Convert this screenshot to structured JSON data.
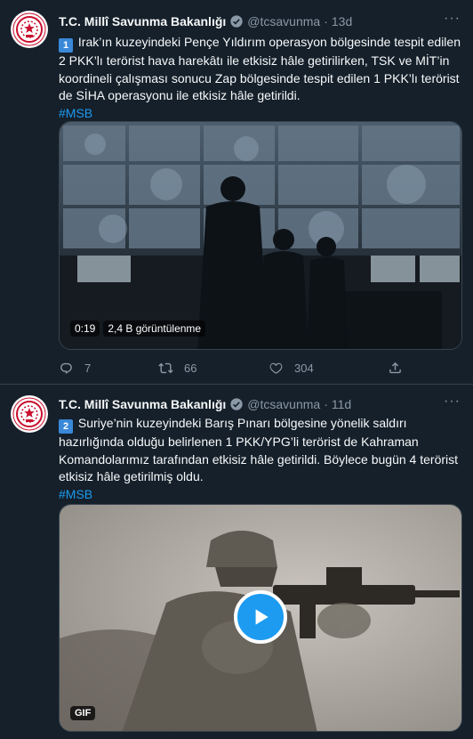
{
  "tweets": [
    {
      "author_name": "T.C. Millî Savunma Bakanlığı",
      "handle": "@tcsavunma",
      "time": "13d",
      "badge": "1",
      "text": "Irak’ın kuzeyindeki Pençe Yıldırım operasyon bölgesinde tespit edilen 2 PKK’lı terörist hava harekâtı ile etkisiz hâle getirilirken, TSK ve MİT’in koordineli çalışması sonucu Zap bölgesinde tespit edilen 1 PKK’lı terörist de SİHA operasyonu ile etkisiz hâle getirildi.",
      "hashtag": "#MSB",
      "video_time": "0:19",
      "video_views": "2,4 B görüntülenme",
      "replies": "7",
      "retweets": "66",
      "likes": "304"
    },
    {
      "author_name": "T.C. Millî Savunma Bakanlığı",
      "handle": "@tcsavunma",
      "time": "11d",
      "badge": "2",
      "text": "Suriye’nin kuzeyindeki Barış Pınarı bölgesine yönelik saldırı hazırlığında olduğu belirlenen 1 PKK/YPG’li terörist de Kahraman Komandolarımız tarafından etkisiz hâle getirildi. Böylece bugün 4 terörist etkisiz hâle getirilmiş oldu.",
      "hashtag": "#MSB",
      "gif_label": "GIF"
    }
  ],
  "colors": {
    "background": "#15202b",
    "accent": "#1d9bf0",
    "muted": "#8b98a5",
    "divider": "#38444d"
  },
  "icons": {
    "reply": "reply-icon",
    "retweet": "retweet-icon",
    "like": "heart-icon",
    "share": "share-icon",
    "verified": "verified-badge-icon",
    "more": "more-icon",
    "play": "play-icon"
  }
}
